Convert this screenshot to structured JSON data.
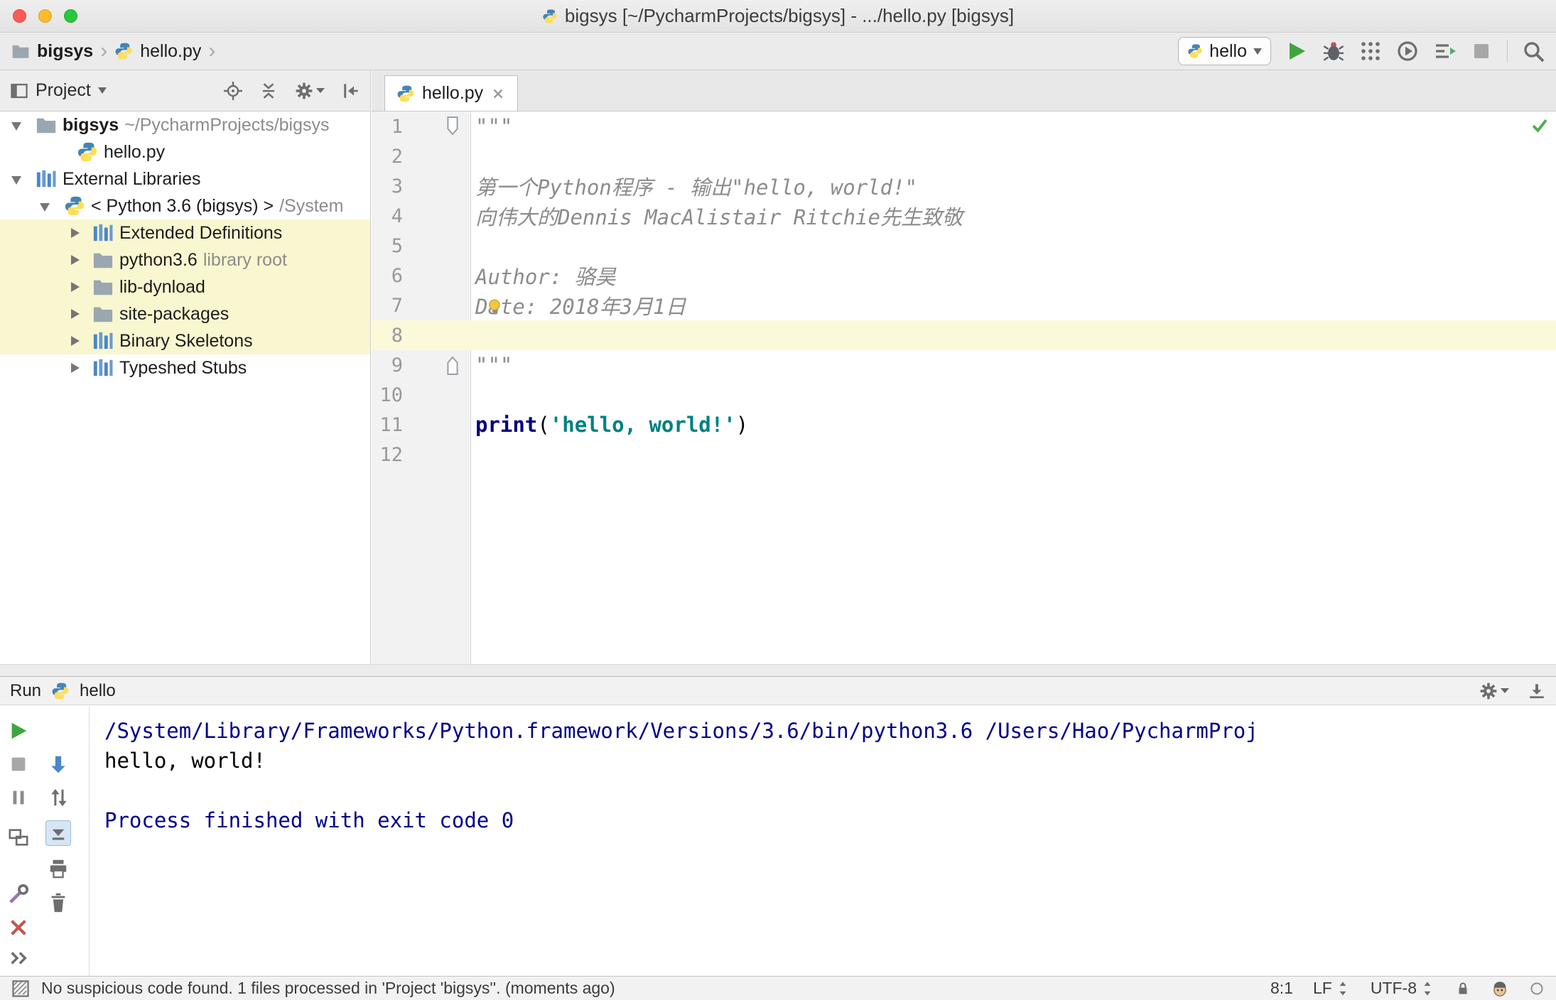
{
  "titlebar": {
    "title": "bigsys [~/PycharmProjects/bigsys] - .../hello.py [bigsys]"
  },
  "breadcrumbs": {
    "items": [
      "bigsys",
      "hello.py"
    ]
  },
  "run_controls": {
    "config_name": "hello"
  },
  "project_panel": {
    "title": "Project",
    "tree": [
      {
        "label": "bigsys",
        "suffix": "~/PycharmProjects/bigsys",
        "icon": "folder",
        "state": "expanded",
        "indent": 0,
        "bold": true
      },
      {
        "label": "hello.py",
        "icon": "python",
        "state": "leaf",
        "indent": 2
      },
      {
        "label": "External Libraries",
        "icon": "library",
        "state": "expanded",
        "indent": 0
      },
      {
        "label": "< Python 3.6 (bigsys) >",
        "suffix": "/System",
        "icon": "python",
        "state": "expanded",
        "indent": 1
      },
      {
        "label": "Extended Definitions",
        "icon": "library",
        "state": "collapsed",
        "indent": 2,
        "highlight": true
      },
      {
        "label": "python3.6",
        "suffix": "library root",
        "icon": "folder",
        "state": "collapsed",
        "indent": 2,
        "highlight": true
      },
      {
        "label": "lib-dynload",
        "icon": "folder",
        "state": "collapsed",
        "indent": 2,
        "highlight": true
      },
      {
        "label": "site-packages",
        "icon": "folder",
        "state": "collapsed",
        "indent": 2,
        "highlight": true
      },
      {
        "label": "Binary Skeletons",
        "icon": "library",
        "state": "collapsed",
        "indent": 2,
        "highlight": true
      },
      {
        "label": "Typeshed Stubs",
        "icon": "library",
        "state": "collapsed",
        "indent": 2
      }
    ]
  },
  "editor": {
    "tab_label": "hello.py",
    "lines": [
      {
        "num": "1",
        "fold": "top",
        "segments": [
          {
            "t": "\"\"\"",
            "s": "doc"
          }
        ]
      },
      {
        "num": "2",
        "segments": []
      },
      {
        "num": "3",
        "segments": [
          {
            "t": "第一个Python程序 - 输出\"hello, world!\"",
            "s": "doc"
          }
        ]
      },
      {
        "num": "4",
        "segments": [
          {
            "t": "向伟大的Dennis MacAlistair Ritchie先生致敬",
            "s": "doc"
          }
        ]
      },
      {
        "num": "5",
        "segments": []
      },
      {
        "num": "6",
        "segments": [
          {
            "t": "Author: 骆昊",
            "s": "doc"
          }
        ]
      },
      {
        "num": "7",
        "segments": [
          {
            "t": "Date: 2018年3月1日",
            "s": "doc"
          }
        ]
      },
      {
        "num": "8",
        "current": true,
        "segments": []
      },
      {
        "num": "9",
        "fold": "bottom",
        "segments": [
          {
            "t": "\"\"\"",
            "s": "doc"
          }
        ]
      },
      {
        "num": "10",
        "segments": []
      },
      {
        "num": "11",
        "segments": [
          {
            "t": "print",
            "s": "kw"
          },
          {
            "t": "(",
            "s": "plain"
          },
          {
            "t": "'hello, world!'",
            "s": "str"
          },
          {
            "t": ")",
            "s": "plain"
          }
        ]
      },
      {
        "num": "12",
        "segments": []
      }
    ]
  },
  "run_panel": {
    "title": "Run",
    "config_name": "hello",
    "console_lines": [
      {
        "t": "/System/Library/Frameworks/Python.framework/Versions/3.6/bin/python3.6 /Users/Hao/PycharmProj",
        "s": "sys"
      },
      {
        "t": "hello, world!",
        "s": "out"
      },
      {
        "t": "",
        "s": "out"
      },
      {
        "t": "Process finished with exit code 0",
        "s": "sys"
      }
    ]
  },
  "statusbar": {
    "message": "No suspicious code found. 1 files processed in 'Project 'bigsys''. (moments ago)",
    "caret_position": "8:1",
    "line_separator": "LF",
    "encoding": "UTF-8"
  },
  "colors": {
    "accent_green": "#3fa53f",
    "keyword": "#000080",
    "string": "#008080",
    "docstring": "#8c8c8c",
    "console_system": "#00008b",
    "caret_row": "#fcf8da",
    "tree_highlight": "#f9f7d0"
  }
}
